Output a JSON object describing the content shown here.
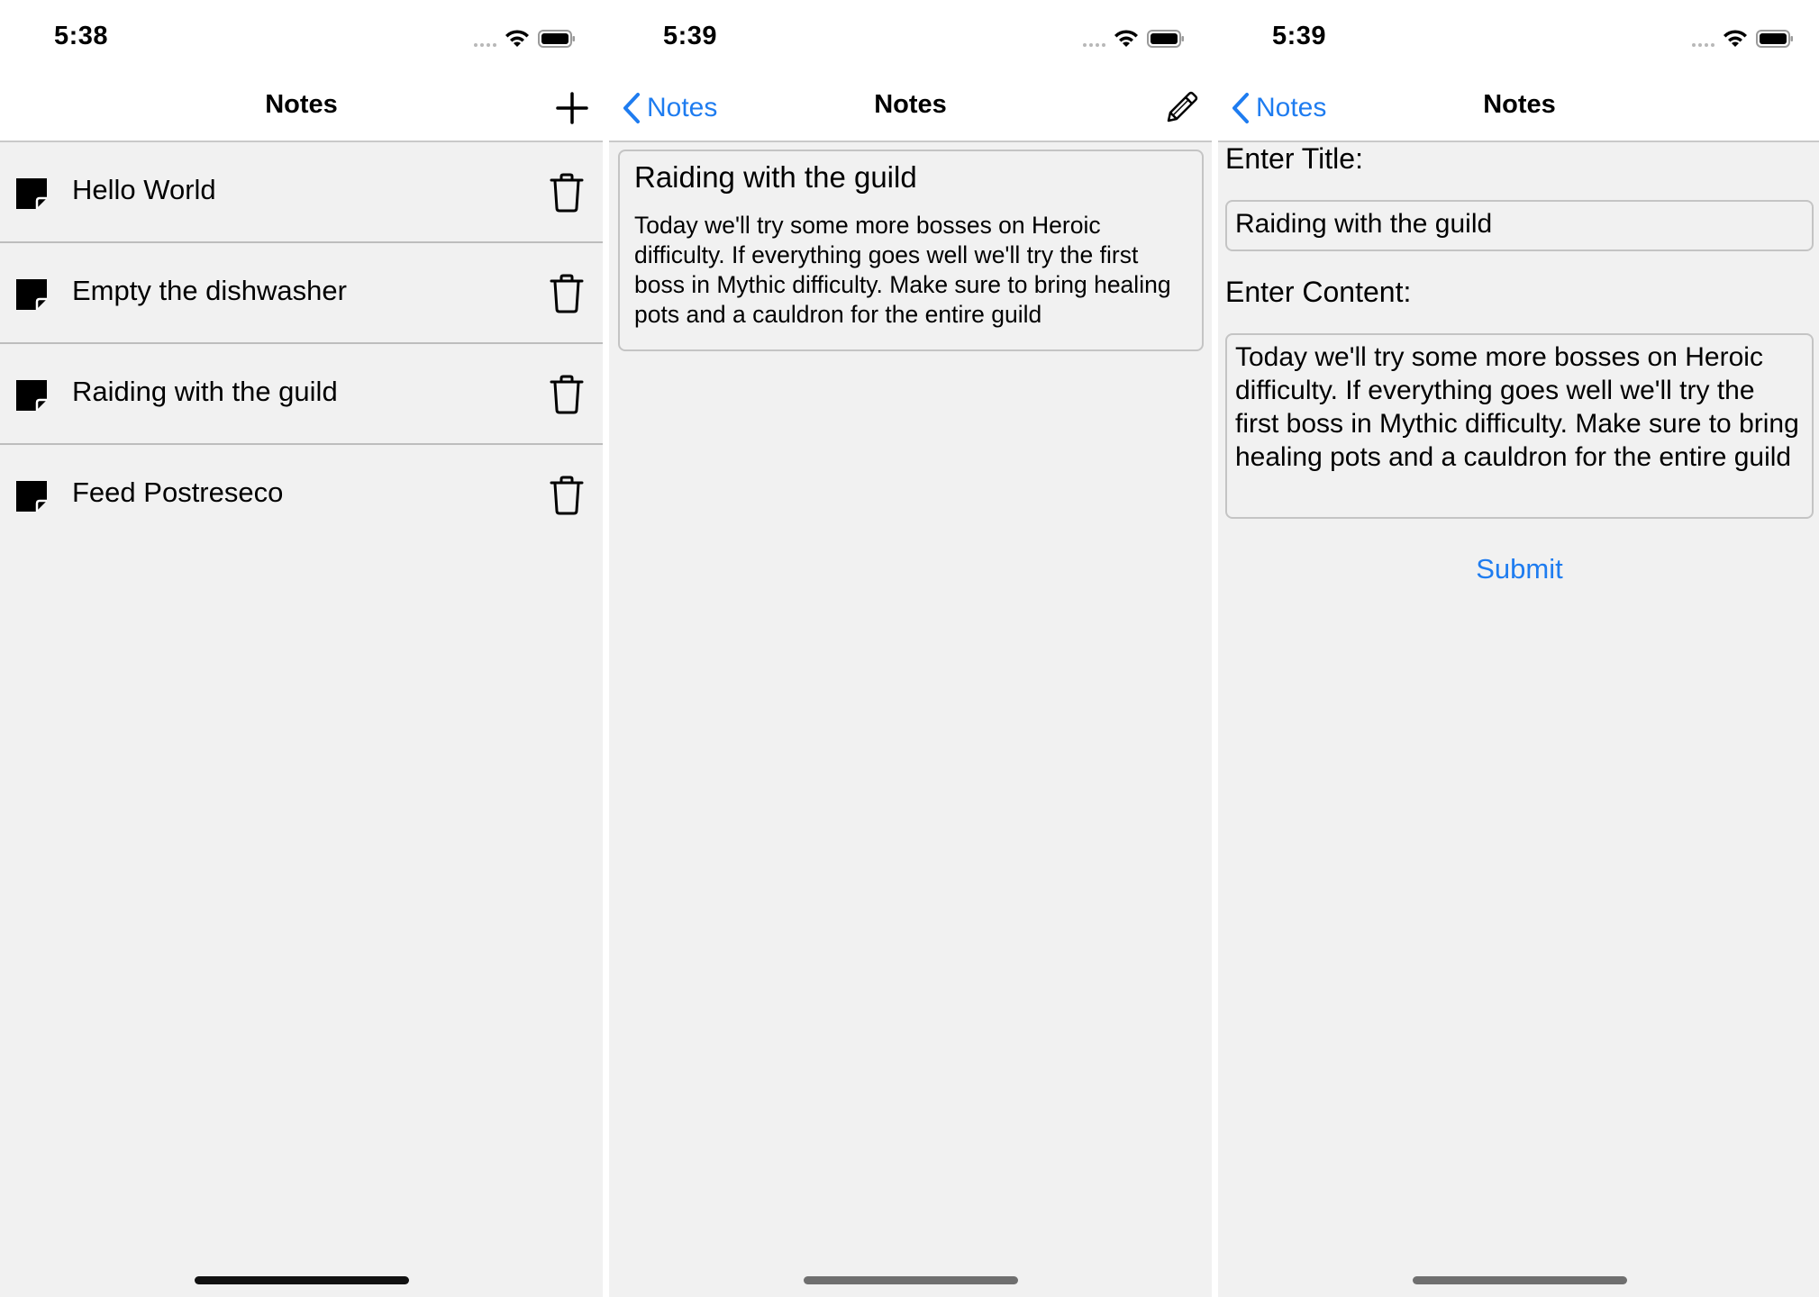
{
  "colors": {
    "accent": "#1e7cf0",
    "background": "#f1f1f1",
    "divider": "#bdbdbd"
  },
  "screens": [
    {
      "status_time": "5:38",
      "nav_title": "Notes",
      "right_action_icon": "plus-icon",
      "notes": [
        {
          "title": "Hello World"
        },
        {
          "title": "Empty the dishwasher"
        },
        {
          "title": "Raiding with the guild"
        },
        {
          "title": "Feed Postreseco"
        }
      ]
    },
    {
      "status_time": "5:39",
      "back_label": "Notes",
      "nav_title": "Notes",
      "right_action_icon": "pencil-icon",
      "note_title": "Raiding with the guild",
      "note_content": "Today we'll try some more bosses on Heroic difficulty. If everything goes well we'll try the first boss in Mythic difficulty. Make sure to bring healing pots and a cauldron for the entire guild"
    },
    {
      "status_time": "5:39",
      "back_label": "Notes",
      "nav_title": "Notes",
      "title_label": "Enter Title:",
      "title_value": "Raiding with the guild",
      "content_label": "Enter Content:",
      "content_value": "Today we'll try some more bosses on Heroic difficulty. If everything goes well we'll try the first boss in Mythic difficulty. Make sure to bring healing pots and a cauldron for the entire guild",
      "submit_label": "Submit"
    }
  ]
}
